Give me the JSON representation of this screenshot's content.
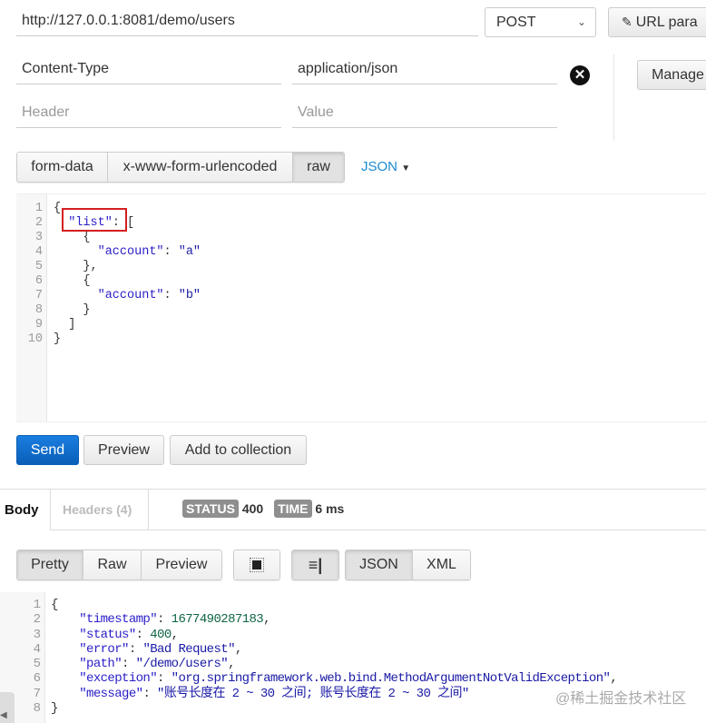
{
  "request": {
    "url": "http://127.0.0.1:8081/demo/users",
    "method": "POST",
    "url_params_label": "URL para",
    "manage_label": "Manage",
    "headers": [
      {
        "key": "Content-Type",
        "value": "application/json"
      }
    ],
    "header_placeholder": "Header",
    "value_placeholder": "Value",
    "body_types": [
      "form-data",
      "x-www-form-urlencoded",
      "raw"
    ],
    "active_body_type": "raw",
    "raw_format": "JSON",
    "body_lines": [
      [
        [
          "p",
          "{"
        ]
      ],
      [
        [
          "p",
          "  "
        ],
        [
          "k",
          "\"list\""
        ],
        [
          "p",
          ": ["
        ]
      ],
      [
        [
          "p",
          "    {"
        ]
      ],
      [
        [
          "p",
          "      "
        ],
        [
          "k",
          "\"account\""
        ],
        [
          "p",
          ": "
        ],
        [
          "s",
          "\"a\""
        ]
      ],
      [
        [
          "p",
          "    },"
        ]
      ],
      [
        [
          "p",
          "    {"
        ]
      ],
      [
        [
          "p",
          "      "
        ],
        [
          "k",
          "\"account\""
        ],
        [
          "p",
          ": "
        ],
        [
          "s",
          "\"b\""
        ]
      ],
      [
        [
          "p",
          "    }"
        ]
      ],
      [
        [
          "p",
          "  ]"
        ]
      ],
      [
        [
          "p",
          "}"
        ]
      ]
    ],
    "actions": {
      "send": "Send",
      "preview": "Preview",
      "add_to_collection": "Add to collection"
    }
  },
  "response": {
    "tabs": {
      "body": "Body",
      "headers": "Headers (4)"
    },
    "status_label": "STATUS",
    "status": "400",
    "time_label": "TIME",
    "time": "6 ms",
    "view_modes": [
      "Pretty",
      "Raw",
      "Preview"
    ],
    "formats": [
      "JSON",
      "XML"
    ],
    "body_lines": [
      [
        [
          "p",
          "{"
        ]
      ],
      [
        [
          "p",
          "    "
        ],
        [
          "k",
          "\"timestamp\""
        ],
        [
          "p",
          ": "
        ],
        [
          "n",
          "1677490287183"
        ],
        [
          "p",
          ","
        ]
      ],
      [
        [
          "p",
          "    "
        ],
        [
          "k",
          "\"status\""
        ],
        [
          "p",
          ": "
        ],
        [
          "n",
          "400"
        ],
        [
          "p",
          ","
        ]
      ],
      [
        [
          "p",
          "    "
        ],
        [
          "k",
          "\"error\""
        ],
        [
          "p",
          ": "
        ],
        [
          "s",
          "\"Bad Request\""
        ],
        [
          "p",
          ","
        ]
      ],
      [
        [
          "p",
          "    "
        ],
        [
          "k",
          "\"path\""
        ],
        [
          "p",
          ": "
        ],
        [
          "s",
          "\"/demo/users\""
        ],
        [
          "p",
          ","
        ]
      ],
      [
        [
          "p",
          "    "
        ],
        [
          "k",
          "\"exception\""
        ],
        [
          "p",
          ": "
        ],
        [
          "s",
          "\"org.springframework.web.bind.MethodArgumentNotValidException\""
        ],
        [
          "p",
          ","
        ]
      ],
      [
        [
          "p",
          "    "
        ],
        [
          "k",
          "\"message\""
        ],
        [
          "p",
          ": "
        ],
        [
          "s",
          "\"账号长度在 2 ~ 30 之间; 账号长度在 2 ~ 30 之间\""
        ]
      ],
      [
        [
          "p",
          "}"
        ]
      ]
    ]
  },
  "watermark": "@稀土掘金技术社区"
}
